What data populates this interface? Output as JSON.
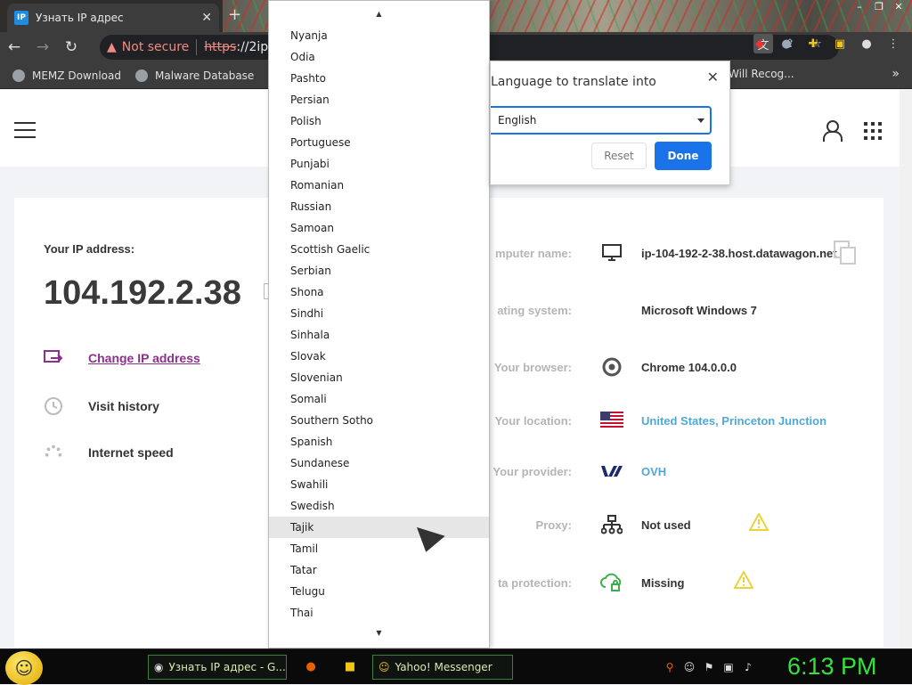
{
  "browser": {
    "tab_title": "Узнать IP адрес",
    "tab_favicon": "IP",
    "not_secure": "Not secure",
    "url_scheme": "https",
    "url_host": "://2ip.ru"
  },
  "bookmarks": {
    "items": [
      {
        "label": "MEMZ Download"
      },
      {
        "label": "Malware Database"
      }
    ],
    "right_label": "Will Recog..."
  },
  "site": {
    "ip_label": "Your IP address:",
    "ip_value": "104.192.2.38",
    "menu": [
      {
        "label": "Change IP address",
        "icon": "change-ip-icon"
      },
      {
        "label": "Visit history",
        "icon": "history-icon"
      },
      {
        "label": "Internet speed",
        "icon": "speed-icon"
      }
    ],
    "info": [
      {
        "key": "mputer name:",
        "value": "ip-104-192-2-38.host.datawagon.net",
        "icon": "monitor-icon"
      },
      {
        "key": "ating system:",
        "value": "Microsoft Windows 7",
        "icon": "os-icon"
      },
      {
        "key": "Your browser:",
        "value": "Chrome 104.0.0.0",
        "icon": "chrome-icon"
      },
      {
        "key": "Your location:",
        "value": "United States, Princeton Junction",
        "icon": "us-flag-icon"
      },
      {
        "key": "Your provider:",
        "value": "OVH",
        "icon": "ovh-logo-icon"
      },
      {
        "key": "Proxy:",
        "value": "Not used",
        "icon": "network-icon"
      },
      {
        "key": "ta protection:",
        "value": "Missing",
        "icon": "cloud-lock-icon"
      }
    ]
  },
  "language_dropdown": {
    "options": [
      "Nyanja",
      "Odia",
      "Pashto",
      "Persian",
      "Polish",
      "Portuguese",
      "Punjabi",
      "Romanian",
      "Russian",
      "Samoan",
      "Scottish Gaelic",
      "Serbian",
      "Shona",
      "Sindhi",
      "Sinhala",
      "Slovak",
      "Slovenian",
      "Somali",
      "Southern Sotho",
      "Spanish",
      "Sundanese",
      "Swahili",
      "Swedish",
      "Tajik",
      "Tamil",
      "Tatar",
      "Telugu",
      "Thai"
    ],
    "highlighted": "Tajik"
  },
  "translate_popup": {
    "title": "Language to translate into",
    "selected": "English",
    "reset": "Reset",
    "done": "Done"
  },
  "taskbar": {
    "chrome_label": "Узнать IP адрес - G...",
    "yahoo_label": "Yahoo! Messenger",
    "clock": "6:13 PM"
  },
  "colors": {
    "link_purple": "#8e2f8e",
    "value_blue": "#4fa9d6",
    "done_blue": "#1a73e8",
    "clock_green": "#35e23a",
    "warning_yellow": "#e8d43a"
  }
}
